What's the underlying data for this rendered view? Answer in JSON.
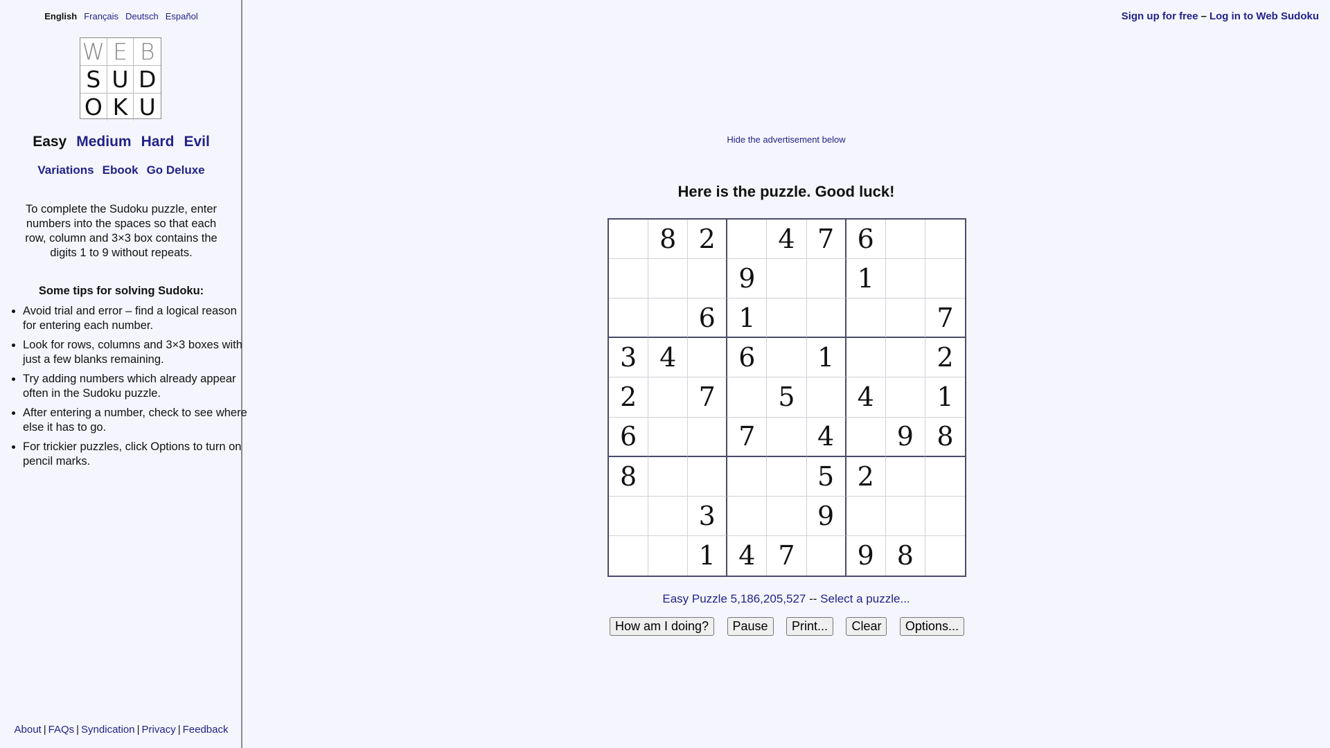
{
  "languages": [
    {
      "label": "English",
      "current": true
    },
    {
      "label": "Français",
      "current": false
    },
    {
      "label": "Deutsch",
      "current": false
    },
    {
      "label": "Español",
      "current": false
    }
  ],
  "logo": {
    "letters": [
      "W",
      "E",
      "B",
      "S",
      "U",
      "D",
      "O",
      "K",
      "U"
    ]
  },
  "levels": [
    "Easy",
    "Medium",
    "Hard",
    "Evil"
  ],
  "current_level": "Easy",
  "extra_links": [
    "Variations",
    "Ebook",
    "Go Deluxe"
  ],
  "intro": "To complete the Sudoku puzzle, enter numbers into the spaces so that each row, column and 3×3 box contains the digits 1 to 9 without repeats.",
  "tips_title": "Some tips for solving Sudoku:",
  "tips": [
    "Avoid trial and error – find a logical reason for entering each number.",
    "Look for rows, columns and 3×3 boxes with just a few blanks remaining.",
    "Try adding numbers which already appear often in the Sudoku puzzle.",
    "After entering a number, check to see where else it has to go.",
    "For trickier puzzles, click Options to turn on pencil marks."
  ],
  "footer": [
    "About",
    "FAQs",
    "Syndication",
    "Privacy",
    "Feedback"
  ],
  "auth": {
    "signup": "Sign up for free",
    "dash": "–",
    "login": "Log in to Web Sudoku"
  },
  "hide_ad": "Hide the advertisement below",
  "headline": "Here is the puzzle. Good luck!",
  "grid": [
    [
      "",
      "8",
      "2",
      "",
      "4",
      "7",
      "6",
      "",
      ""
    ],
    [
      "",
      "",
      "",
      "9",
      "",
      "",
      "1",
      "",
      ""
    ],
    [
      "",
      "",
      "6",
      "1",
      "",
      "",
      "",
      "",
      "7"
    ],
    [
      "3",
      "4",
      "",
      "6",
      "",
      "1",
      "",
      "",
      "2"
    ],
    [
      "2",
      "",
      "7",
      "",
      "5",
      "",
      "4",
      "",
      "1"
    ],
    [
      "6",
      "",
      "",
      "7",
      "",
      "4",
      "",
      "9",
      "8"
    ],
    [
      "8",
      "",
      "",
      "",
      "",
      "5",
      "2",
      "",
      ""
    ],
    [
      "",
      "",
      "3",
      "",
      "",
      "9",
      "",
      "",
      ""
    ],
    [
      "",
      "",
      "1",
      "4",
      "7",
      "",
      "9",
      "8",
      ""
    ]
  ],
  "puzzle_info": {
    "label": "Easy Puzzle 5,186,205,527",
    "sep": "--",
    "select": "Select a puzzle..."
  },
  "buttons": [
    "How am I doing?",
    "Pause",
    "Print...",
    "Clear",
    "Options..."
  ]
}
